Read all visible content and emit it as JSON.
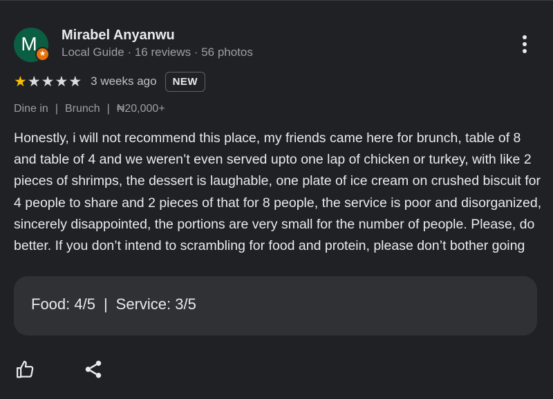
{
  "reviewer": {
    "initial": "M",
    "name": "Mirabel Anyanwu",
    "meta": "Local Guide · 16 reviews · 56 photos",
    "avatar_color": "#0b5e41",
    "badge_color": "#e8710a",
    "badge_icon": "star-icon"
  },
  "rating": {
    "stars": 1,
    "max_stars": 5,
    "time_ago": "3 weeks ago",
    "badge": "NEW",
    "filled_color": "#fbbc04"
  },
  "visit": {
    "service": "Dine in",
    "meal": "Brunch",
    "price": "₦20,000+"
  },
  "review_text": "Honestly, i will not recommend this place, my friends came here for brunch, table of 8 and table of 4 and we weren’t even served upto one lap of chicken or turkey, with like 2 pieces of shrimps, the dessert is laughable, one plate of ice cream on crushed biscuit for 4 people to share and 2 pieces of that for 8 people, the service is poor and disorganized, sincerely disappointed, the portions are very small for the number of people. Please, do better. If you don’t intend to scrambling for food and protein, please don’t bother going",
  "sub_ratings": {
    "food": "Food: 4/5",
    "separator": "|",
    "service": "Service: 3/5"
  },
  "actions": {
    "like_icon": "thumbs-up-icon",
    "share_icon": "share-icon",
    "menu_icon": "more-vert-icon"
  }
}
